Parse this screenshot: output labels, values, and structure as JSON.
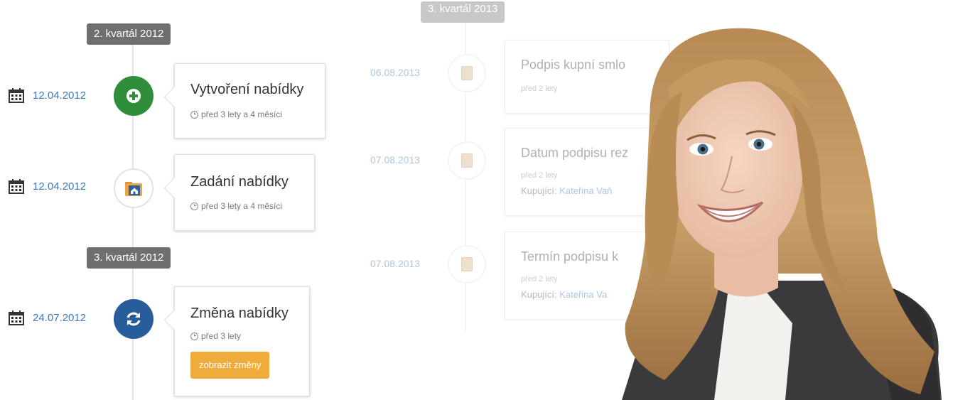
{
  "timeline": {
    "quarters": [
      {
        "label": "2. kvartál 2012"
      },
      {
        "label": "3. kvartál 2012"
      }
    ],
    "events": [
      {
        "date": "12.04.2012",
        "title": "Vytvoření nabídky",
        "ago": "před 3 lety a 4 měsíci",
        "icon": "plus-icon",
        "color": "#2e8e3a"
      },
      {
        "date": "12.04.2012",
        "title": "Zadání nabídky",
        "ago": "před 3 lety a 4 měsíci",
        "icon": "house-folder-icon"
      },
      {
        "date": "24.07.2012",
        "title": "Změna nabídky",
        "ago": "před 3 lety",
        "icon": "refresh-icon",
        "color": "#275d9a",
        "button": "zobrazit změny"
      }
    ]
  },
  "faded_timeline": {
    "quarter": "3. kvartál 2013",
    "events": [
      {
        "date": "06.08.2013",
        "title": "Podpis kupní smlo",
        "ago": "před 2 lety"
      },
      {
        "date": "07.08.2013",
        "title": "Datum podpisu rez",
        "ago": "před 2 lety",
        "buyer_label": "Kupující:",
        "buyer_name": "Kateřina Vaň"
      },
      {
        "date": "07.08.2013",
        "title": "Termín podpisu k",
        "ago": "před 2 lety",
        "buyer_label": "Kupující:",
        "buyer_name": "Kateřina Va"
      }
    ]
  },
  "colors": {
    "accent": "#3d78b8",
    "button": "#f0ac3a",
    "label_bg": "#6f6f6f"
  }
}
